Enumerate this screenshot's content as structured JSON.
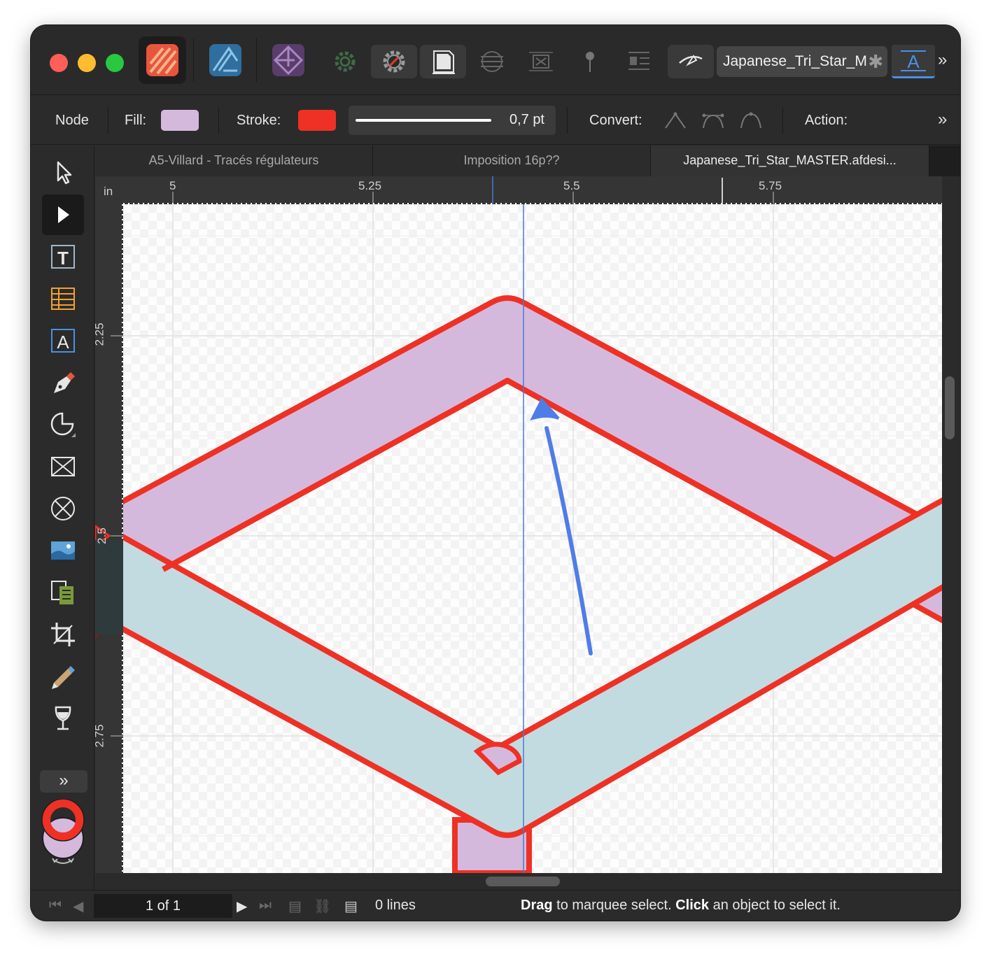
{
  "window": {
    "document_title": "Japanese_Tri_Star_M",
    "modified_mark": "✱"
  },
  "personas": [
    {
      "name": "Designer",
      "icon": "designer-persona-icon"
    },
    {
      "name": "Designer Vector",
      "icon": "designer-vector-persona-icon"
    },
    {
      "name": "Photo",
      "icon": "photo-persona-icon"
    }
  ],
  "context": {
    "mode_label": "Node",
    "fill_label": "Fill:",
    "fill_color": "#d5b9dd",
    "stroke_label": "Stroke:",
    "stroke_color": "#ee3124",
    "stroke_width": "0,7 pt",
    "convert_label": "Convert:",
    "action_label": "Action:",
    "more": "»"
  },
  "tabs": [
    {
      "label": "A5-Villard - Tracés régulateurs",
      "active": false
    },
    {
      "label": "Imposition 16p??",
      "active": false
    },
    {
      "label": "Japanese_Tri_Star_MASTER.afdesi...",
      "active": true
    }
  ],
  "ruler": {
    "unit": "in",
    "h_labels": [
      "5",
      "5.25",
      "5.5",
      "5.75"
    ],
    "v_labels": [
      "2.25",
      "2.5",
      "2.75"
    ]
  },
  "tools_more": "»",
  "status": {
    "page_field": "1 of 1",
    "lines": "0 lines",
    "hint_drag": "Drag",
    "hint_mid": " to marquee select. ",
    "hint_click": "Click",
    "hint_end": " an object to select it."
  },
  "colors": {
    "purple_fill": "#d5b9dd",
    "teal_fill": "#c2dbe0",
    "stroke_red": "#ee3124",
    "annotation_blue": "#4f7de8"
  }
}
